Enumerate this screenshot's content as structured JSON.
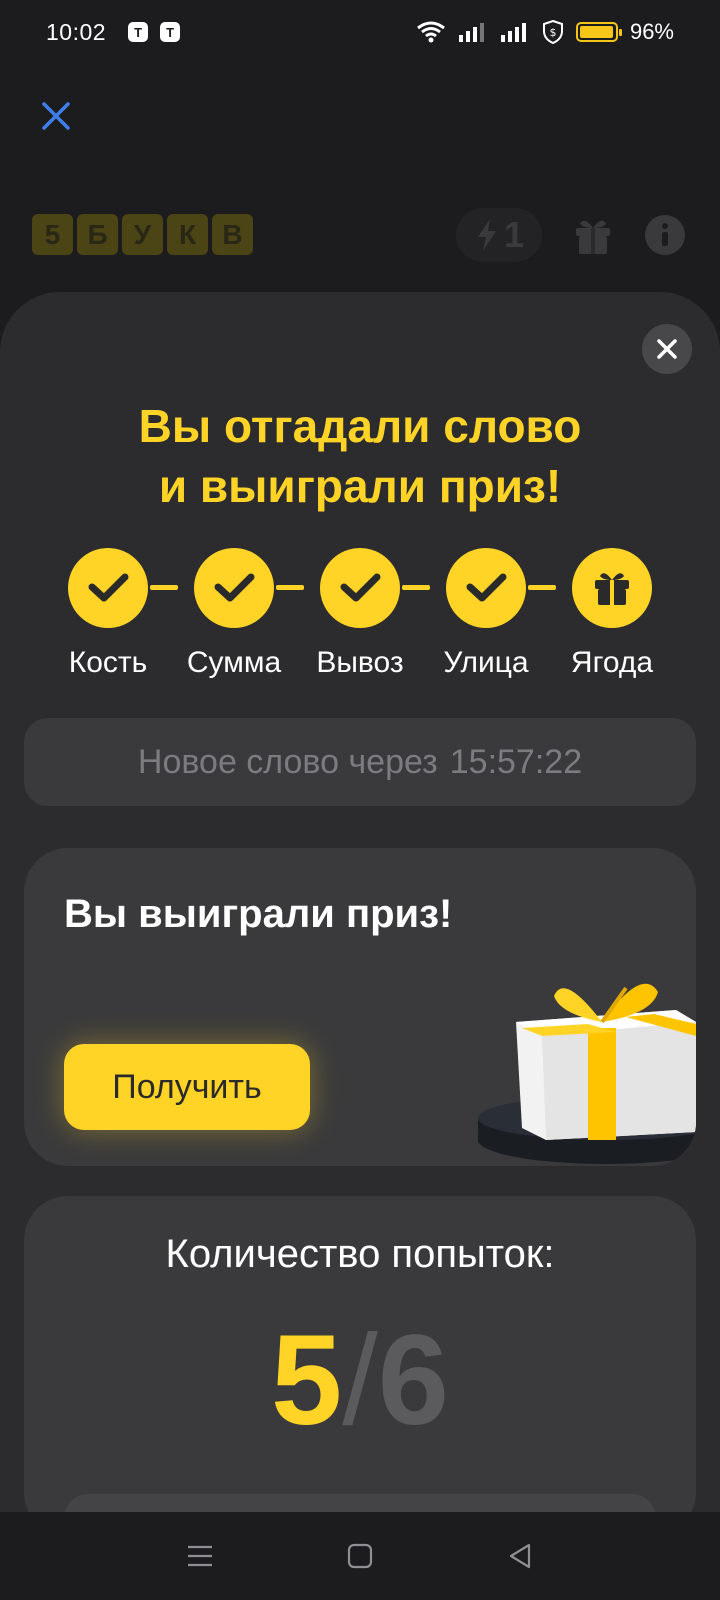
{
  "status_bar": {
    "time": "10:02",
    "notification_icons": [
      "tinkoff-icon",
      "tinkoff-icon"
    ],
    "battery_percent": "96%",
    "battery_level": 0.96,
    "battery_color": "#f5c518"
  },
  "header": {
    "logo_letters": [
      "5",
      "Б",
      "У",
      "К",
      "В"
    ],
    "energy_count": "1"
  },
  "sheet": {
    "title_line1": "Вы отгадали слово",
    "title_line2": "и выиграли приз!",
    "steps": [
      {
        "label": "Кость",
        "icon": "check-icon"
      },
      {
        "label": "Сумма",
        "icon": "check-icon"
      },
      {
        "label": "Вывоз",
        "icon": "check-icon"
      },
      {
        "label": "Улица",
        "icon": "check-icon"
      },
      {
        "label": "Ягода",
        "icon": "gift-icon"
      }
    ],
    "timer_text": "Новое слово через",
    "timer_value": "15:57:22",
    "prize_title": "Вы выиграли приз!",
    "get_button_label": "Получить",
    "attempts_title": "Количество попыток:",
    "attempts_used": "5",
    "attempts_sep": "/",
    "attempts_total": "6"
  },
  "colors": {
    "accent": "#ffd426",
    "background": "#1c1c1e",
    "sheet": "#2c2c2e",
    "card": "#3a3a3c",
    "close_x_blue": "#3d7eea"
  }
}
